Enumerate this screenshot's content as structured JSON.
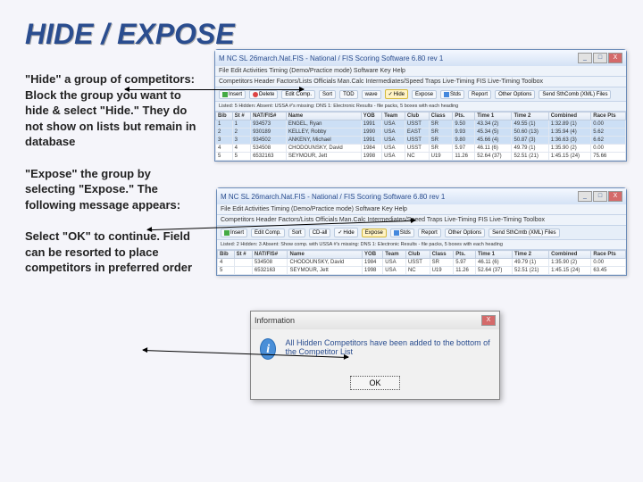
{
  "title": "HIDE / EXPOSE",
  "para1": "\"Hide\" a group of competitors: Block the group you want to hide & select \"Hide.\" They do not show on lists but remain in database",
  "para2": "\"Expose\" the group by selecting \"Expose.\" The following message appears:",
  "para3": "Select \"OK\" to continue. Field can be resorted to place competitors in preferred order",
  "win1": {
    "title": "M NC SL 26march.Nat.FIS - National / FIS Scoring Software 6.80 rev 1",
    "menu": "File  Edit  Activities  Timing (Demo/Practice mode)  Software Key  Help",
    "tabs": "Competitors  Header  Factors/Lists  Officials  Man.Calc  Intermediates/Speed Traps  Live-Timing  FIS Live-Timing  Toolbox",
    "toolbar": {
      "b1": "Insert",
      "b2": "Delete",
      "b3": "Edit Comp.",
      "b4": "Sort",
      "b5": "TOD",
      "b6": "wave",
      "b7": "Hide",
      "b8": "Expose",
      "b9": "Stds",
      "b10": "Report",
      "b11": "Other Options",
      "b12": "Send SthComb (XML) Files"
    },
    "extra": "Listed: 5  Hidden:  Absent:  USSA #'s missing:  DNS 1:  Electronic Results - file packs, 5 boxes with each heading",
    "headers": [
      "Bib",
      "St #",
      "NAT/FIS#",
      "Name",
      "YOB",
      "Team",
      "Club",
      "Class",
      "Pts.",
      "Time 1",
      "Time 2",
      "Combined",
      "Race Pts"
    ],
    "rows": [
      [
        "1",
        "1",
        "934573",
        "ENGEL, Ryan",
        "1991",
        "USA",
        "USST",
        "SR",
        "9.50",
        "43.34 (2)",
        "49.55 (1)",
        "1:32.89 (1)",
        "0.00"
      ],
      [
        "2",
        "2",
        "930189",
        "KELLEY, Robby",
        "1990",
        "USA",
        "EAST",
        "SR",
        "9.93",
        "45.34 (5)",
        "50.60 (13)",
        "1:35.94 (4)",
        "5.62"
      ],
      [
        "3",
        "3",
        "934502",
        "ANKENY, Michael",
        "1991",
        "USA",
        "USST",
        "SR",
        "9.80",
        "45.66 (4)",
        "50.87 (3)",
        "1:36.63 (3)",
        "6.62"
      ],
      [
        "4",
        "4",
        "534508",
        "CHODOUNSKY, David",
        "1984",
        "USA",
        "USST",
        "SR",
        "5.97",
        "46.11 (6)",
        "49.79 (1)",
        "1:35.90 (2)",
        "0.00"
      ],
      [
        "5",
        "5",
        "6532163",
        "SEYMOUR, Jett",
        "1998",
        "USA",
        "NC",
        "U19",
        "11.26",
        "52.64 (37)",
        "52.51 (21)",
        "1:45.15 (24)",
        "75.66"
      ]
    ]
  },
  "win2": {
    "title": "M NC SL 26march.Nat.FIS - National / FIS Scoring Software 6.80 rev 1",
    "menu": "File  Edit  Activities  Timing (Demo/Practice mode)  Software Key  Help",
    "tabs": "Competitors  Header  Factors/Lists  Officials  Man.Calc  Intermediates/Speed Traps  Live-Timing  FIS Live-Timing  Toolbox",
    "toolbar": {
      "b1": "Insert",
      "b2": "Edit Comp.",
      "b3": "Sort",
      "b4": "CD-all",
      "b5": "Hide",
      "b6": "Expose",
      "b7": "Stds",
      "b8": "Report",
      "b9": "Other Options",
      "b10": "Send SthCmtb (XML) Files"
    },
    "extra": "Listed: 2  Hidden: 3  Absent:  Show comp. with USSA #'s missing:  DNS 1:  Electronic Results - file packs, 5 boxes with each heading",
    "headers": [
      "Bib",
      "St #",
      "NAT/FIS#",
      "Name",
      "YOB",
      "Team",
      "Club",
      "Class",
      "Pts.",
      "Time 1",
      "Time 2",
      "Combined",
      "Race Pts"
    ],
    "rows": [
      [
        "4",
        "",
        "534508",
        "CHODOUNSKY, David",
        "1984",
        "USA",
        "USST",
        "SR",
        "5.97",
        "46.11 (6)",
        "49.79 (1)",
        "1:35.90 (2)",
        "0.00"
      ],
      [
        "5",
        "",
        "6532163",
        "SEYMOUR, Jett",
        "1998",
        "USA",
        "NC",
        "U19",
        "11.26",
        "52.64 (37)",
        "52.51 (21)",
        "1:45.15 (24)",
        "63.45"
      ]
    ]
  },
  "dialog": {
    "title": "Information",
    "msg": "All Hidden Competitors have been added to the bottom of the Competitor List",
    "ok": "OK"
  }
}
